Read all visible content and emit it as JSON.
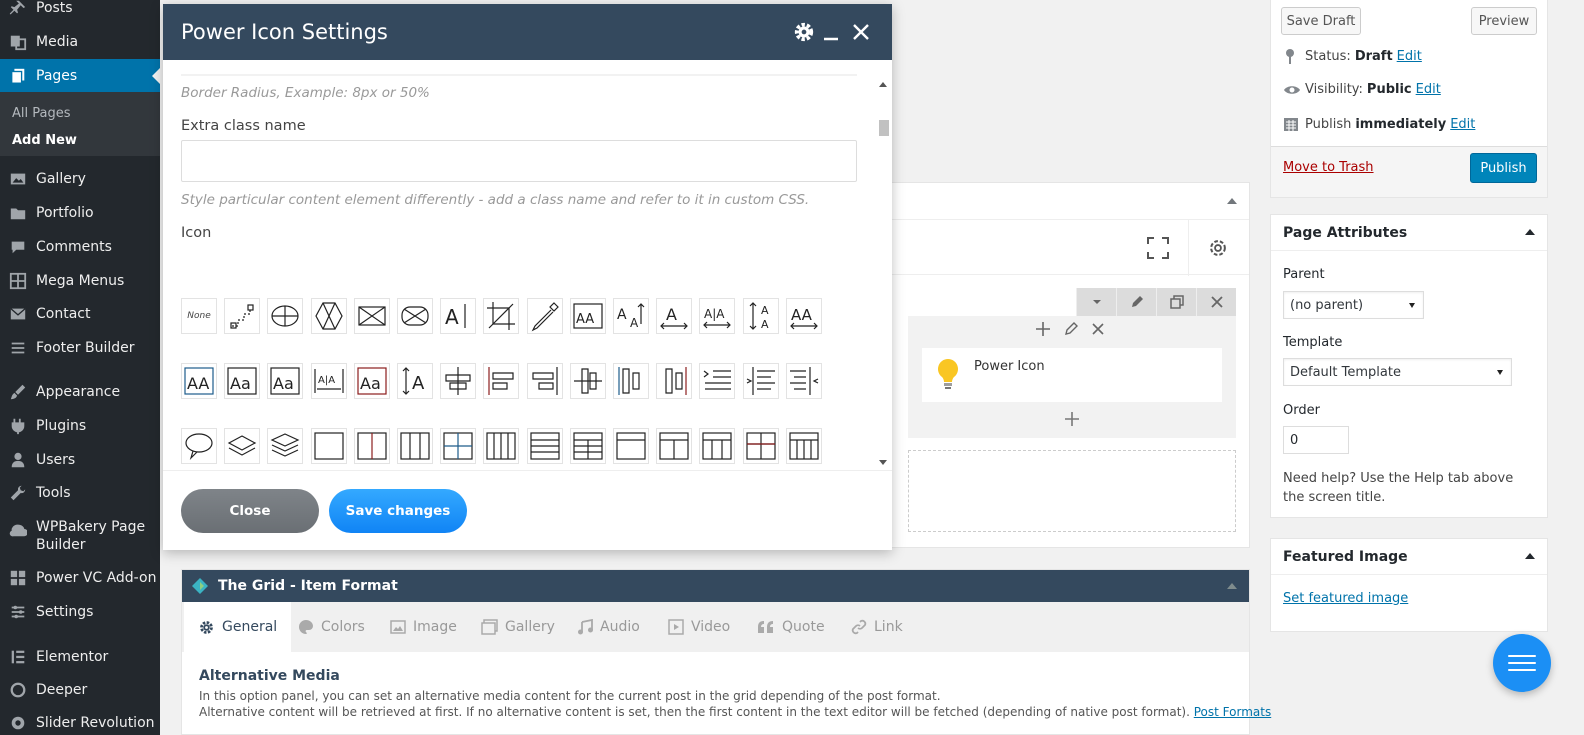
{
  "sidebar": {
    "items": [
      {
        "label": "Posts",
        "icon": "pin-icon"
      },
      {
        "label": "Media",
        "icon": "media-icon"
      },
      {
        "label": "Pages",
        "icon": "pages-icon"
      },
      {
        "label": "Gallery",
        "icon": "gallery-icon"
      },
      {
        "label": "Portfolio",
        "icon": "portfolio-icon"
      },
      {
        "label": "Comments",
        "icon": "comments-icon"
      },
      {
        "label": "Mega Menus",
        "icon": "grid-icon"
      },
      {
        "label": "Contact",
        "icon": "mail-icon"
      },
      {
        "label": "Footer Builder",
        "icon": "menu-icon"
      },
      {
        "label": "Appearance",
        "icon": "brush-icon"
      },
      {
        "label": "Plugins",
        "icon": "plugin-icon"
      },
      {
        "label": "Users",
        "icon": "users-icon"
      },
      {
        "label": "Tools",
        "icon": "wrench-icon"
      },
      {
        "label": "WPBakery Page Builder",
        "icon": "wpbakery-icon"
      },
      {
        "label": "Power VC Add-on",
        "icon": "grid-icon"
      },
      {
        "label": "Settings",
        "icon": "settings-icon"
      },
      {
        "label": "Elementor",
        "icon": "elementor-icon"
      },
      {
        "label": "Deeper",
        "icon": "deeper-icon"
      },
      {
        "label": "Slider Revolution",
        "icon": "slider-icon"
      }
    ],
    "submenu": [
      "All Pages",
      "Add New"
    ]
  },
  "publish": {
    "save_draft": "Save Draft",
    "preview": "Preview",
    "status_label": "Status:",
    "status_value": "Draft",
    "visibility_label": "Visibility:",
    "visibility_value": "Public",
    "publish_label": "Publish",
    "publish_value": "immediately",
    "edit": "Edit",
    "move_to_trash": "Move to Trash",
    "publish_button": "Publish"
  },
  "page_attributes": {
    "title": "Page Attributes",
    "parent_label": "Parent",
    "parent_value": "(no parent)",
    "template_label": "Template",
    "template_value": "Default Template",
    "order_label": "Order",
    "order_value": "0",
    "help": "Need help? Use the Help tab above the screen title."
  },
  "featured_image": {
    "title": "Featured Image",
    "link": "Set featured image"
  },
  "builder": {
    "element_name": "Power Icon"
  },
  "grid": {
    "title": "The Grid - Item Format",
    "tabs": [
      "General",
      "Colors",
      "Image",
      "Gallery",
      "Audio",
      "Video",
      "Quote",
      "Link"
    ],
    "section_title": "Alternative Media",
    "desc_line1": "In this option panel, you can set an alternative media content for the current post in the grid depending of the post format.",
    "desc_line2": "Alternative content will be retrieved at first. If no alternative content is set, then the first content in the text editor will be fetched (depending of native post format).",
    "desc_link": "Post Formats"
  },
  "modal": {
    "title": "Power Icon Settings",
    "border_radius_hint": "Border Radius, Example: 8px or 50%",
    "extra_class_label": "Extra class name",
    "extra_class_value": "",
    "extra_class_hint": "Style particular content element differently - add a class name and refer to it in custom CSS.",
    "icon_label": "Icon",
    "icon_none": "None",
    "close_button": "Close",
    "save_button": "Save changes"
  },
  "colors": {
    "sidebar_bg": "#23282d",
    "wp_blue": "#0073aa",
    "modal_header": "#34495e",
    "save_blue": "#1b8ff5"
  }
}
